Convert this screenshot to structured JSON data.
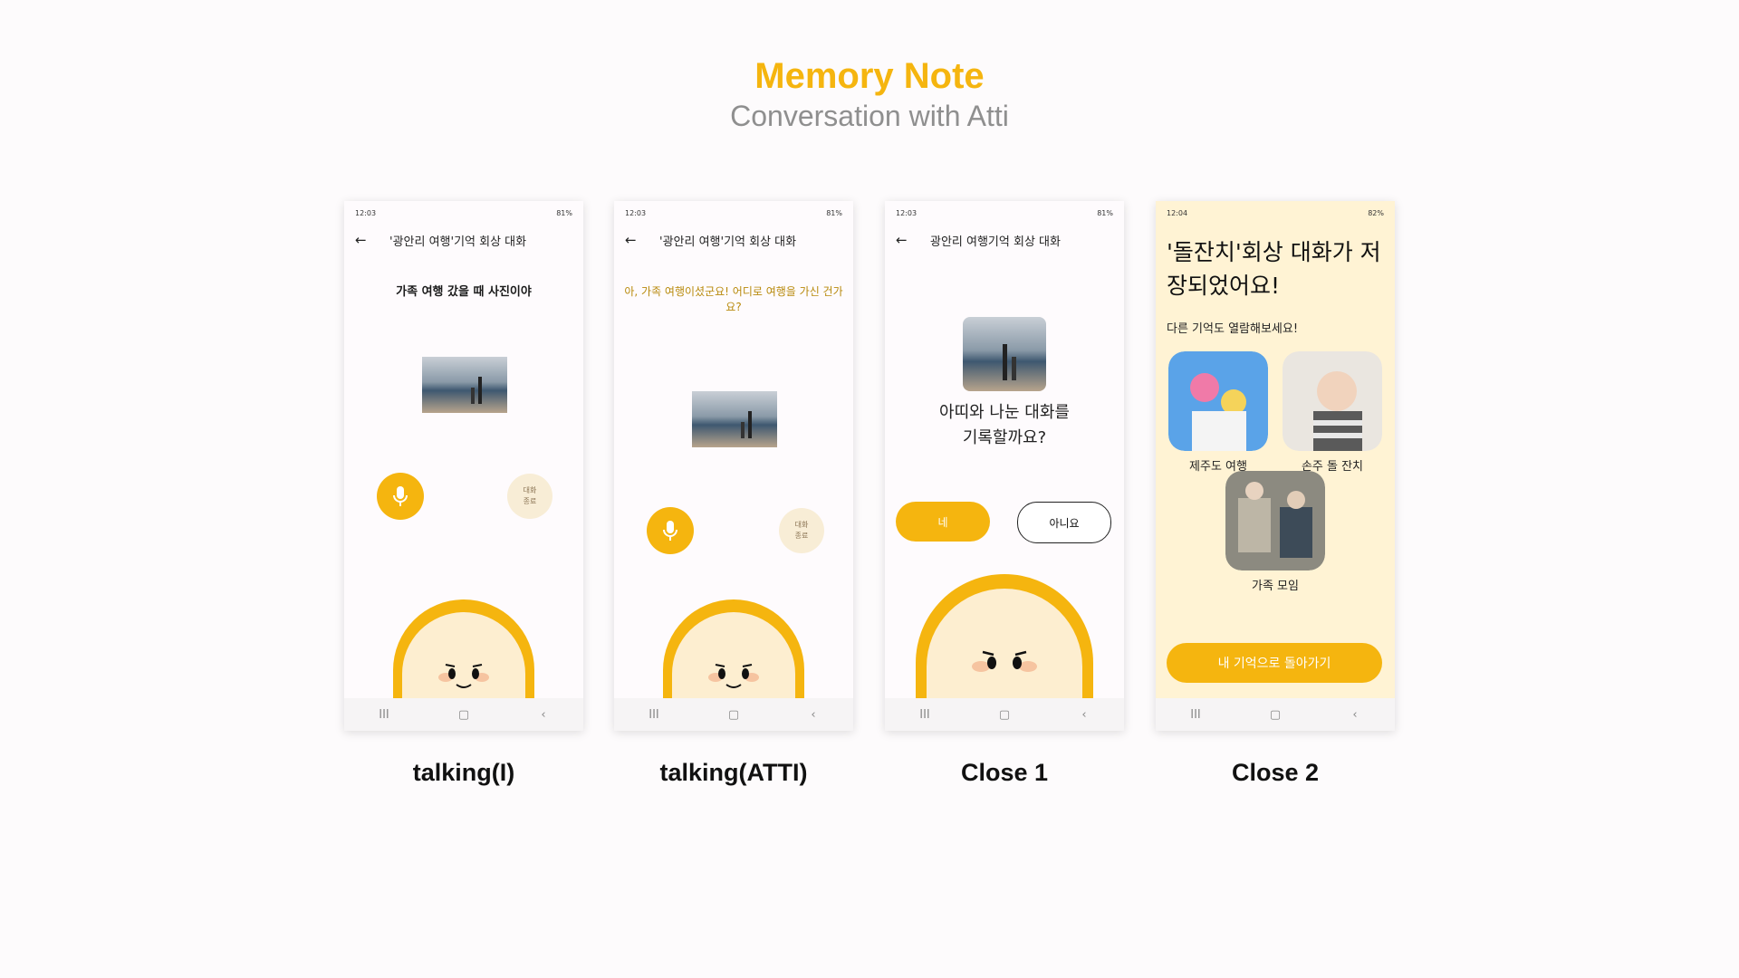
{
  "header": {
    "title": "Memory Note",
    "subtitle": "Conversation with Atti"
  },
  "colors": {
    "accent": "#f5b50f",
    "cream": "#fff3d4",
    "text": "#1a1a1a",
    "muted": "#8f8f8f"
  },
  "screens": [
    {
      "caption": "talking(I)",
      "status": {
        "time": "12:03",
        "battery": "81%"
      },
      "appbar_title": "'광안리 여행'기억 회상 대화",
      "prompt": "가족 여행 갔을 때 사진이야",
      "end_button": "대화\n종료"
    },
    {
      "caption": "talking(ATTI)",
      "status": {
        "time": "12:03",
        "battery": "81%"
      },
      "appbar_title": "'광안리 여행'기억 회상 대화",
      "prompt": "아, 가족 여행이셨군요! 어디로 여행을 가신 건가요?",
      "end_button": "대화\n종료"
    },
    {
      "caption": "Close 1",
      "status": {
        "time": "12:03",
        "battery": "81%"
      },
      "appbar_title": "광안리 여행기억 회상 대화",
      "question": "아띠와 나눈 대화를\n기록할까요?",
      "yes_label": "네",
      "no_label": "아니요"
    },
    {
      "caption": "Close 2",
      "status": {
        "time": "12:04",
        "battery": "82%"
      },
      "heading": "'돌잔치'회상 대화가 저장되었어요!",
      "sub": "다른 기억도 열람해보세요!",
      "memories": [
        "제주도 여행",
        "손주 돌 잔치",
        "가족 모임"
      ],
      "back_label": "내 기억으로 돌아가기"
    }
  ],
  "navbar": {
    "recent": "III",
    "home": "▢",
    "back": "‹"
  },
  "icons": {
    "back": "arrow-left-icon",
    "mic": "microphone-icon"
  }
}
